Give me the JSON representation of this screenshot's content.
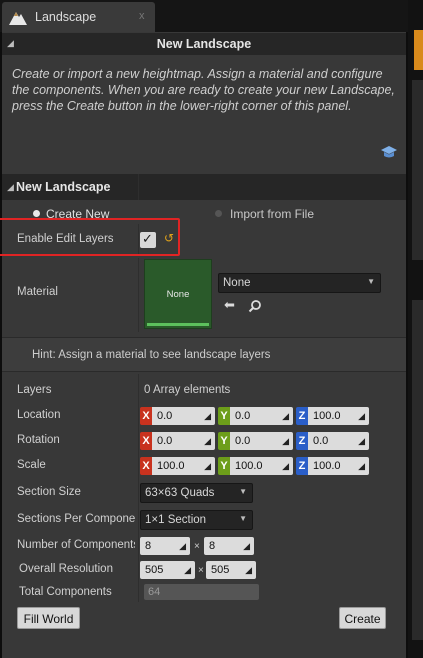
{
  "tab": {
    "label": "Landscape",
    "close": "x"
  },
  "header": {
    "title": "New Landscape"
  },
  "description": "Create or import a new heightmap.  Assign a material and configure the components.  When you are ready to create your new Landscape, press the Create button in the lower-right corner of this panel.",
  "section": {
    "title": "New Landscape"
  },
  "mode": {
    "options": [
      "Create New",
      "Import from File"
    ],
    "selected": "Create New"
  },
  "enable_edit_layers": {
    "label": "Enable Edit Layers",
    "checked": true
  },
  "material": {
    "label": "Material",
    "thumbnail_text": "None",
    "selected": "None"
  },
  "hint": "Hint: Assign a material to see landscape layers",
  "layers": {
    "label": "Layers",
    "value": "0 Array elements"
  },
  "location": {
    "label": "Location",
    "x": "0.0",
    "y": "0.0",
    "z": "100.0"
  },
  "rotation": {
    "label": "Rotation",
    "x": "0.0",
    "y": "0.0",
    "z": "0.0"
  },
  "scale": {
    "label": "Scale",
    "x": "100.0",
    "y": "100.0",
    "z": "100.0"
  },
  "section_size": {
    "label": "Section Size",
    "value": "63×63 Quads"
  },
  "sections_per_component": {
    "label": "Sections Per Component",
    "value": "1×1 Section"
  },
  "number_of_components": {
    "label": "Number of Components",
    "x": "8",
    "y": "8"
  },
  "overall_resolution": {
    "label": "Overall Resolution",
    "x": "505",
    "y": "505"
  },
  "total_components": {
    "label": "Total Components",
    "value": "64"
  },
  "buttons": {
    "fill_world": "Fill World",
    "create": "Create"
  },
  "axis_labels": {
    "x": "X",
    "y": "Y",
    "z": "Z"
  },
  "times_sign": "×",
  "colors": {
    "x_axis": "#c8321e",
    "y_axis": "#6d9e1a",
    "z_axis": "#2a5ec8",
    "highlight": "#e02424",
    "accent": "#d98a1c"
  }
}
